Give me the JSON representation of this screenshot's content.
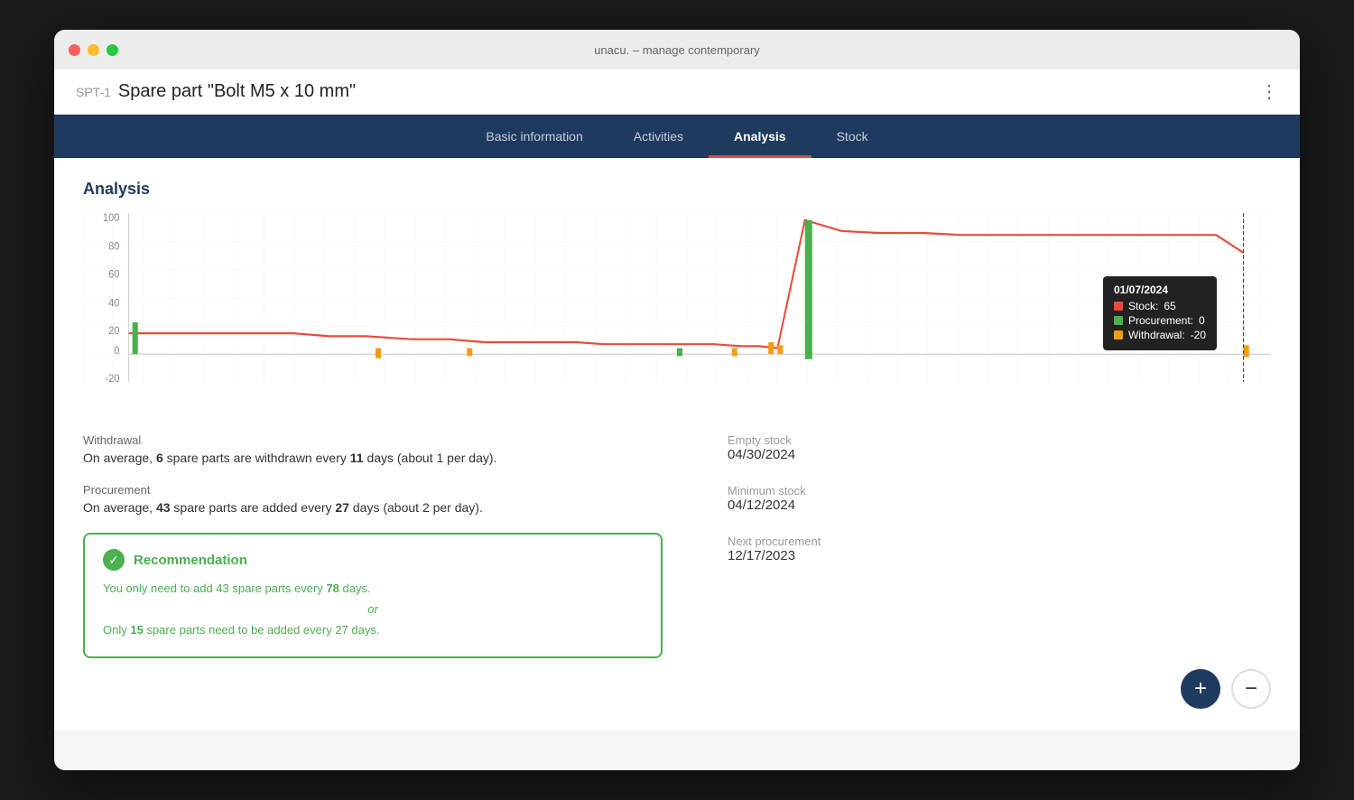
{
  "window": {
    "title": "unacu. – manage contemporary"
  },
  "header": {
    "id": "SPT-1",
    "title": "Spare part \"Bolt M5 x 10 mm\""
  },
  "nav": {
    "tabs": [
      {
        "label": "Basic information",
        "active": false
      },
      {
        "label": "Activities",
        "active": false
      },
      {
        "label": "Analysis",
        "active": true
      },
      {
        "label": "Stock",
        "active": false
      }
    ]
  },
  "content": {
    "section_title": "Analysis",
    "chart": {
      "y_labels": [
        "100",
        "80",
        "60",
        "40",
        "20",
        "0",
        "-20"
      ],
      "tooltip": {
        "date": "01/07/2024",
        "stock_label": "Stock:",
        "stock_value": "65",
        "procurement_label": "Procurement:",
        "procurement_value": "0",
        "withdrawal_label": "Withdrawal:",
        "withdrawal_value": "-20"
      }
    },
    "stats": {
      "withdrawal_label": "Withdrawal",
      "withdrawal_text_pre": "On average,",
      "withdrawal_num": "6",
      "withdrawal_text_mid": "spare parts are withdrawn every",
      "withdrawal_days": "11",
      "withdrawal_text_post": "days (about 1 per day).",
      "procurement_label": "Procurement",
      "procurement_text_pre": "On average,",
      "procurement_num": "43",
      "procurement_text_mid": "spare parts are added every",
      "procurement_days": "27",
      "procurement_text_post": "days (about 2 per day)."
    },
    "right_stats": {
      "empty_stock_label": "Empty stock",
      "empty_stock_value": "04/30/2024",
      "min_stock_label": "Minimum stock",
      "min_stock_value": "04/12/2024",
      "next_procurement_label": "Next procurement",
      "next_procurement_value": "12/17/2023"
    },
    "recommendation": {
      "title": "Recommendation",
      "line1_pre": "You only need to add 43 spare parts every",
      "line1_num": "78",
      "line1_post": "days.",
      "or_text": "or",
      "line2_pre": "Only",
      "line2_num": "15",
      "line2_post": "spare parts need to be added every 27 days."
    },
    "fab_plus": "+",
    "fab_minus": "−"
  },
  "colors": {
    "nav_bg": "#1e3a5f",
    "active_tab_underline": "#e74c3c",
    "section_title": "#1e3a5f",
    "chart_red": "#e74c3c",
    "chart_green": "#4caf50",
    "chart_orange": "#f39c12",
    "recommendation_green": "#4caf50",
    "fab_bg": "#1e3a5f"
  }
}
